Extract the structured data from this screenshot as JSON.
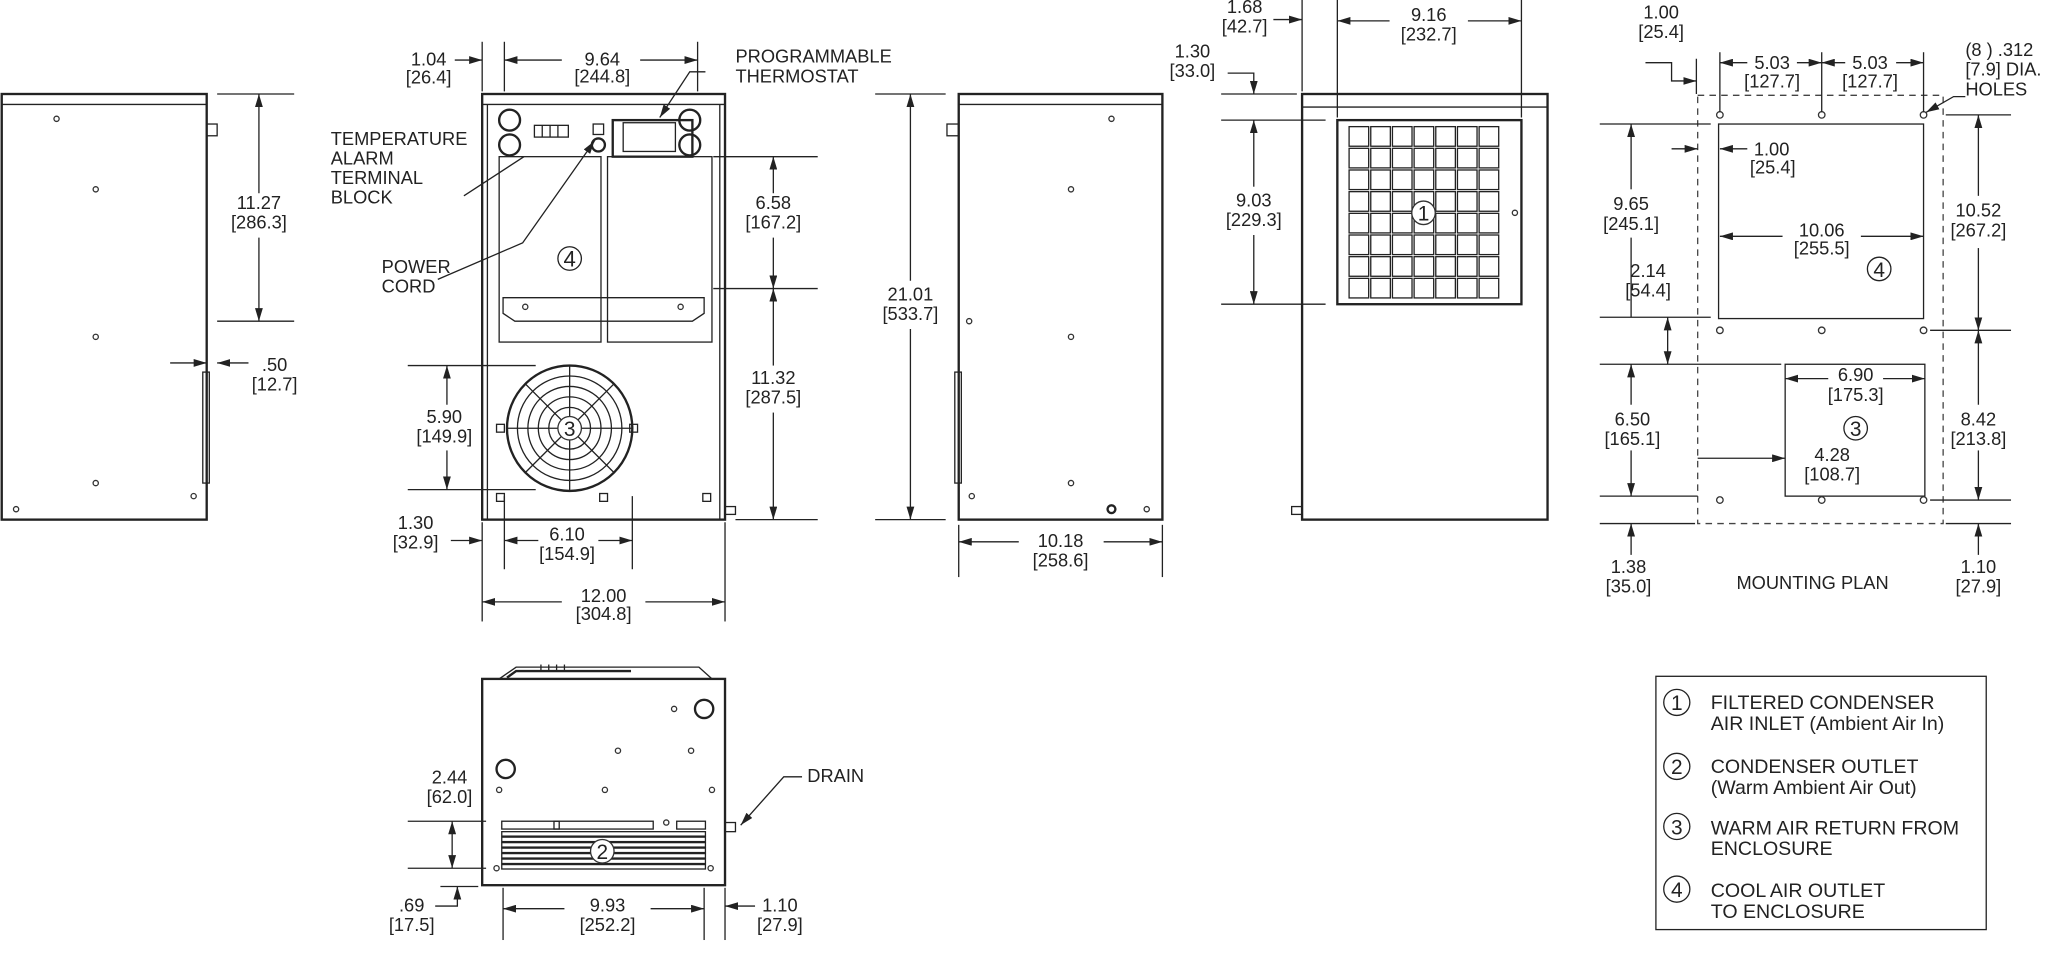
{
  "colors": {
    "line": "#222222",
    "background": "#ffffff"
  },
  "labels": {
    "thermostat": [
      "PROGRAMMABLE",
      "THERMOSTAT"
    ],
    "alarm": [
      "TEMPERATURE",
      "ALARM",
      "TERMINAL",
      "BLOCK"
    ],
    "power": [
      "POWER",
      "CORD"
    ],
    "holes": [
      "(8 ) .312",
      "[7.9] DIA.",
      "HOLES"
    ],
    "mounting_plan": "MOUNTING PLAN",
    "drain": "DRAIN"
  },
  "dims": {
    "a": [
      "11.27",
      "[286.3]"
    ],
    "b": [
      ".50",
      "[12.7]"
    ],
    "c": [
      "1.04",
      "[26.4]"
    ],
    "d": [
      "9.64",
      "[244.8]"
    ],
    "e": [
      "6.58",
      "[167.2]"
    ],
    "f": [
      "11.32",
      "[287.5]"
    ],
    "g": [
      "5.90",
      "[149.9]"
    ],
    "h": [
      "1.30",
      "[32.9]"
    ],
    "i": [
      "6.10",
      "[154.9]"
    ],
    "j": [
      "12.00",
      "[304.8]"
    ],
    "k": [
      "21.01",
      "[533.7]"
    ],
    "l": [
      "10.18",
      "[258.6]"
    ],
    "m": [
      "1.68",
      "[42.7]"
    ],
    "n": [
      "9.16",
      "[232.7]"
    ],
    "o": [
      "1.30",
      "[33.0]"
    ],
    "p": [
      "9.03",
      "[229.3]"
    ],
    "q": [
      "1.00",
      "[25.4]"
    ],
    "r": [
      "5.03",
      "[127.7]"
    ],
    "s": [
      "5.03",
      "[127.7]"
    ],
    "t": [
      "1.00",
      "[25.4]"
    ],
    "u": [
      "9.65",
      "[245.1]"
    ],
    "v": [
      "10.06",
      "[255.5]"
    ],
    "w": [
      "10.52",
      "[267.2]"
    ],
    "x": [
      "2.14",
      "[54.4]"
    ],
    "y": [
      "6.90",
      "[175.3]"
    ],
    "z": [
      "6.50",
      "[165.1]"
    ],
    "aa": [
      "8.42",
      "[213.8]"
    ],
    "ab": [
      "4.28",
      "[108.7]"
    ],
    "ac": [
      "1.38",
      "[35.0]"
    ],
    "ad": [
      "1.10",
      "[27.9]"
    ],
    "ae": [
      "2.44",
      "[62.0]"
    ],
    "af": [
      ".69",
      "[17.5]"
    ],
    "ag": [
      "9.93",
      "[252.2]"
    ],
    "ah": [
      "1.10",
      "[27.9]"
    ]
  },
  "callouts": {
    "one": "1",
    "two": "2",
    "three": "3",
    "four": "4"
  },
  "legend": [
    {
      "num": "1",
      "lines": [
        "FILTERED CONDENSER",
        "AIR INLET (Ambient Air In)"
      ]
    },
    {
      "num": "2",
      "lines": [
        "CONDENSER OUTLET",
        "(Warm Ambient Air Out)"
      ]
    },
    {
      "num": "3",
      "lines": [
        "WARM AIR RETURN FROM",
        "ENCLOSURE"
      ]
    },
    {
      "num": "4",
      "lines": [
        "COOL AIR OUTLET",
        "TO ENCLOSURE"
      ]
    }
  ]
}
